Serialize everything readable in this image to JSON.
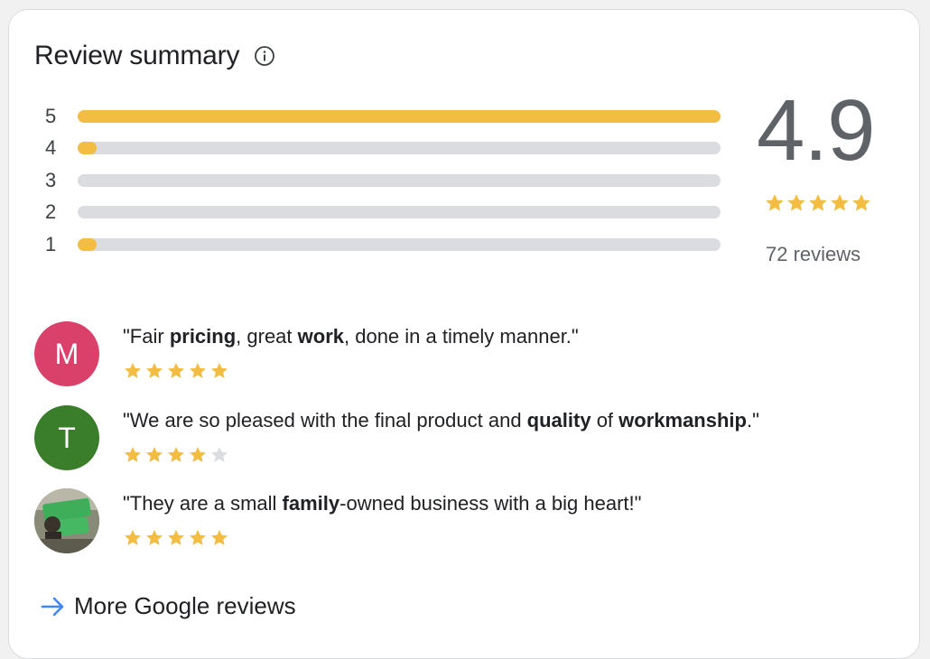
{
  "header": {
    "title": "Review summary"
  },
  "distribution": [
    {
      "label": "5",
      "fraction": 1.0
    },
    {
      "label": "4",
      "fraction": 0.03
    },
    {
      "label": "3",
      "fraction": 0.0
    },
    {
      "label": "2",
      "fraction": 0.0
    },
    {
      "label": "1",
      "fraction": 0.03
    }
  ],
  "overall": {
    "rating": "4.9",
    "stars": 5,
    "count_text": "72 reviews"
  },
  "reviews": [
    {
      "avatar_letter": "M",
      "avatar_color": "#d9416b",
      "segments": [
        {
          "t": "\"Fair ",
          "b": false
        },
        {
          "t": "pricing",
          "b": true
        },
        {
          "t": ", great ",
          "b": false
        },
        {
          "t": "work",
          "b": true
        },
        {
          "t": ", done in a timely manner.\"",
          "b": false
        }
      ],
      "stars": 5
    },
    {
      "avatar_letter": "T",
      "avatar_color": "#3a7d2a",
      "segments": [
        {
          "t": "\"We are so pleased with the final product and ",
          "b": false
        },
        {
          "t": "quality",
          "b": true
        },
        {
          "t": " of ",
          "b": false
        },
        {
          "t": "workmanship",
          "b": true
        },
        {
          "t": ".\"",
          "b": false
        }
      ],
      "stars": 4
    },
    {
      "avatar_letter": "",
      "avatar_color": "#6b7b5a",
      "avatar_photo": true,
      "segments": [
        {
          "t": "\"They are a small ",
          "b": false
        },
        {
          "t": "family",
          "b": true
        },
        {
          "t": "-owned business with a big heart!\"",
          "b": false
        }
      ],
      "stars": 5
    }
  ],
  "more_link": {
    "label": "More Google reviews"
  },
  "colors": {
    "star_filled": "#f2bd42",
    "star_empty": "#dadce0",
    "link_blue": "#4285f4"
  }
}
